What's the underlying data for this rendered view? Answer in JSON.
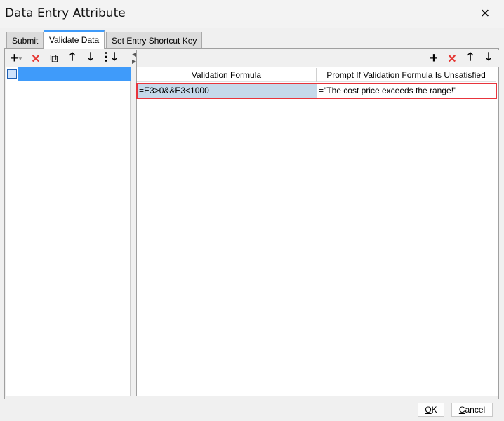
{
  "window": {
    "title": "Data Entry Attribute",
    "close_icon": "×"
  },
  "tabs": [
    {
      "label": "Submit"
    },
    {
      "label": "Validate Data"
    },
    {
      "label": "Set Entry Shortcut Key"
    }
  ],
  "left_toolbar": {
    "add": "+",
    "add_dropdown": "▾",
    "delete": "✕",
    "copy": "⧉",
    "up": "🡑",
    "down": "🡓",
    "move": "⋮🡓"
  },
  "right_toolbar": {
    "add": "+",
    "delete": "✕",
    "up": "🡑",
    "down": "🡓"
  },
  "table": {
    "headers": [
      "Validation Formula",
      "Prompt If Validation Formula Is Unsatisfied"
    ],
    "rows": [
      [
        "=E3>0&&E3<1000",
        "=\"The cost price exceeds the range!\""
      ]
    ]
  },
  "buttons": {
    "ok_mnemonic": "O",
    "ok_rest": "K",
    "cancel_mnemonic": "C",
    "cancel_rest": "ancel"
  }
}
